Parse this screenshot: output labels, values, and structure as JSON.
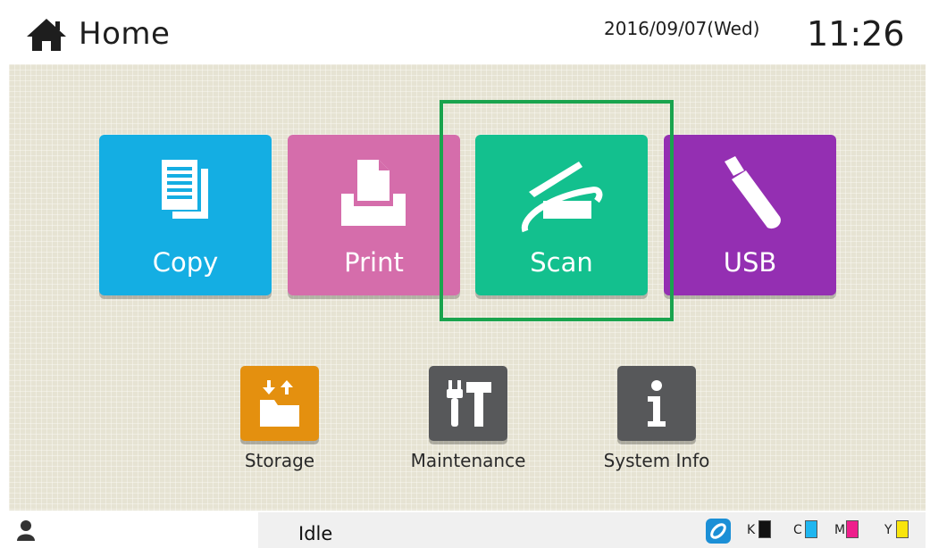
{
  "header": {
    "title": "Home",
    "date": "2016/09/07(Wed)",
    "time": "11:26"
  },
  "tiles": [
    {
      "label": "Copy",
      "color": "#14aee3",
      "icon": "copy-icon"
    },
    {
      "label": "Print",
      "color": "#d56dab",
      "icon": "print-icon"
    },
    {
      "label": "Scan",
      "color": "#13c08e",
      "icon": "scan-icon",
      "selected": true
    },
    {
      "label": "USB",
      "color": "#942fb2",
      "icon": "usb-icon"
    }
  ],
  "small_tiles": [
    {
      "label": "Storage",
      "color": "#e4900f",
      "icon": "storage-folder-icon"
    },
    {
      "label": "Maintenance",
      "color": "#57585a",
      "icon": "maintenance-tools-icon"
    },
    {
      "label": "System Info",
      "color": "#57585a",
      "icon": "info-icon"
    }
  ],
  "footer": {
    "status": "Idle",
    "user_icon": "user-icon",
    "link_icon": "link-icon",
    "inks": [
      {
        "label": "K",
        "color": "#111111"
      },
      {
        "label": "C",
        "color": "#1fb6f0"
      },
      {
        "label": "M",
        "color": "#ee1f8c"
      },
      {
        "label": "Y",
        "color": "#f9e50c"
      }
    ]
  }
}
